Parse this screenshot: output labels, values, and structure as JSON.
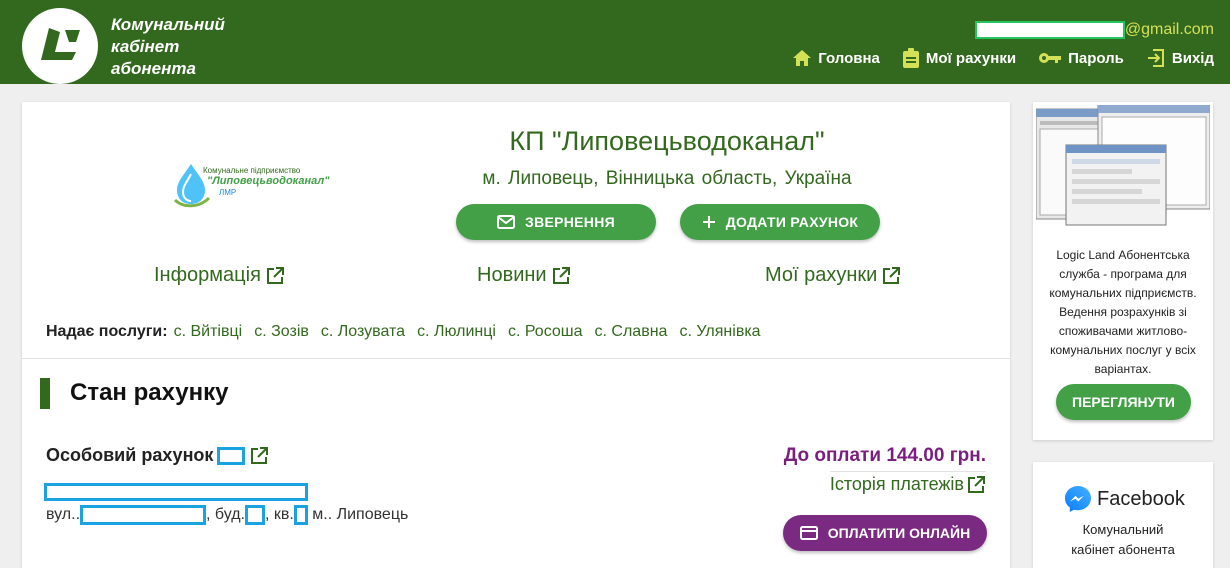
{
  "header": {
    "brand_line1": "Комунальний",
    "brand_line2": "кабінет",
    "brand_line3": "абонента",
    "email_domain": "@gmail.com",
    "nav": {
      "home": "Головна",
      "my_accounts": "Мої рахунки",
      "password": "Пароль",
      "exit": "Вихід"
    }
  },
  "org": {
    "logo_line1": "Комунальне підприємство",
    "logo_line2": "\"Липовецьводоканал\"",
    "logo_line3": "ЛМР",
    "title": "КП \"Липовецьводоканал\"",
    "city": "м. Липовець,",
    "region": "Вінницька область,",
    "country": "Україна",
    "appeal_button": "ЗВЕРНЕННЯ",
    "add_account_button": "ДОДАТИ РАХУНОК",
    "links": {
      "info": "Інформація",
      "news": "Новини",
      "my_accounts": "Мої рахунки"
    },
    "services_label": "Надає послуги:",
    "services": [
      "с. Вйтівці",
      "с. Зозів",
      "с. Лозувата",
      "с. Люлинці",
      "с. Росоша",
      "с. Славна",
      "с. Улянівка"
    ]
  },
  "account": {
    "section_title": "Стан рахунку",
    "label": "Особовий рахунок",
    "addr_street_prefix": "вул..",
    "addr_house_prefix": ", буд.",
    "addr_flat_prefix": ", кв.",
    "addr_city": " м.. Липовець",
    "to_pay": "До оплати 144.00 грн.",
    "history": "Історія платежів",
    "pay_button": "ОПЛАТИТИ ОНЛАЙН"
  },
  "sidebar": {
    "ad_text": "Logic Land Абонентська служба - програма для комунальних підприємств. Ведення розрахунків зі споживачами житлово-комунальних послуг у всіх варіантах.",
    "view_button": "ПЕРЕГЛЯНУТИ",
    "fb_title": "Facebook",
    "fb_sub_line1": "Комунальний",
    "fb_sub_line2": "кабінет абонента"
  },
  "colors": {
    "header_bg": "#33691e",
    "green_button": "#43a047",
    "pay_purple": "#7b2a82",
    "mask_blue": "#1aa3e0",
    "email_accent": "#d4e157"
  }
}
